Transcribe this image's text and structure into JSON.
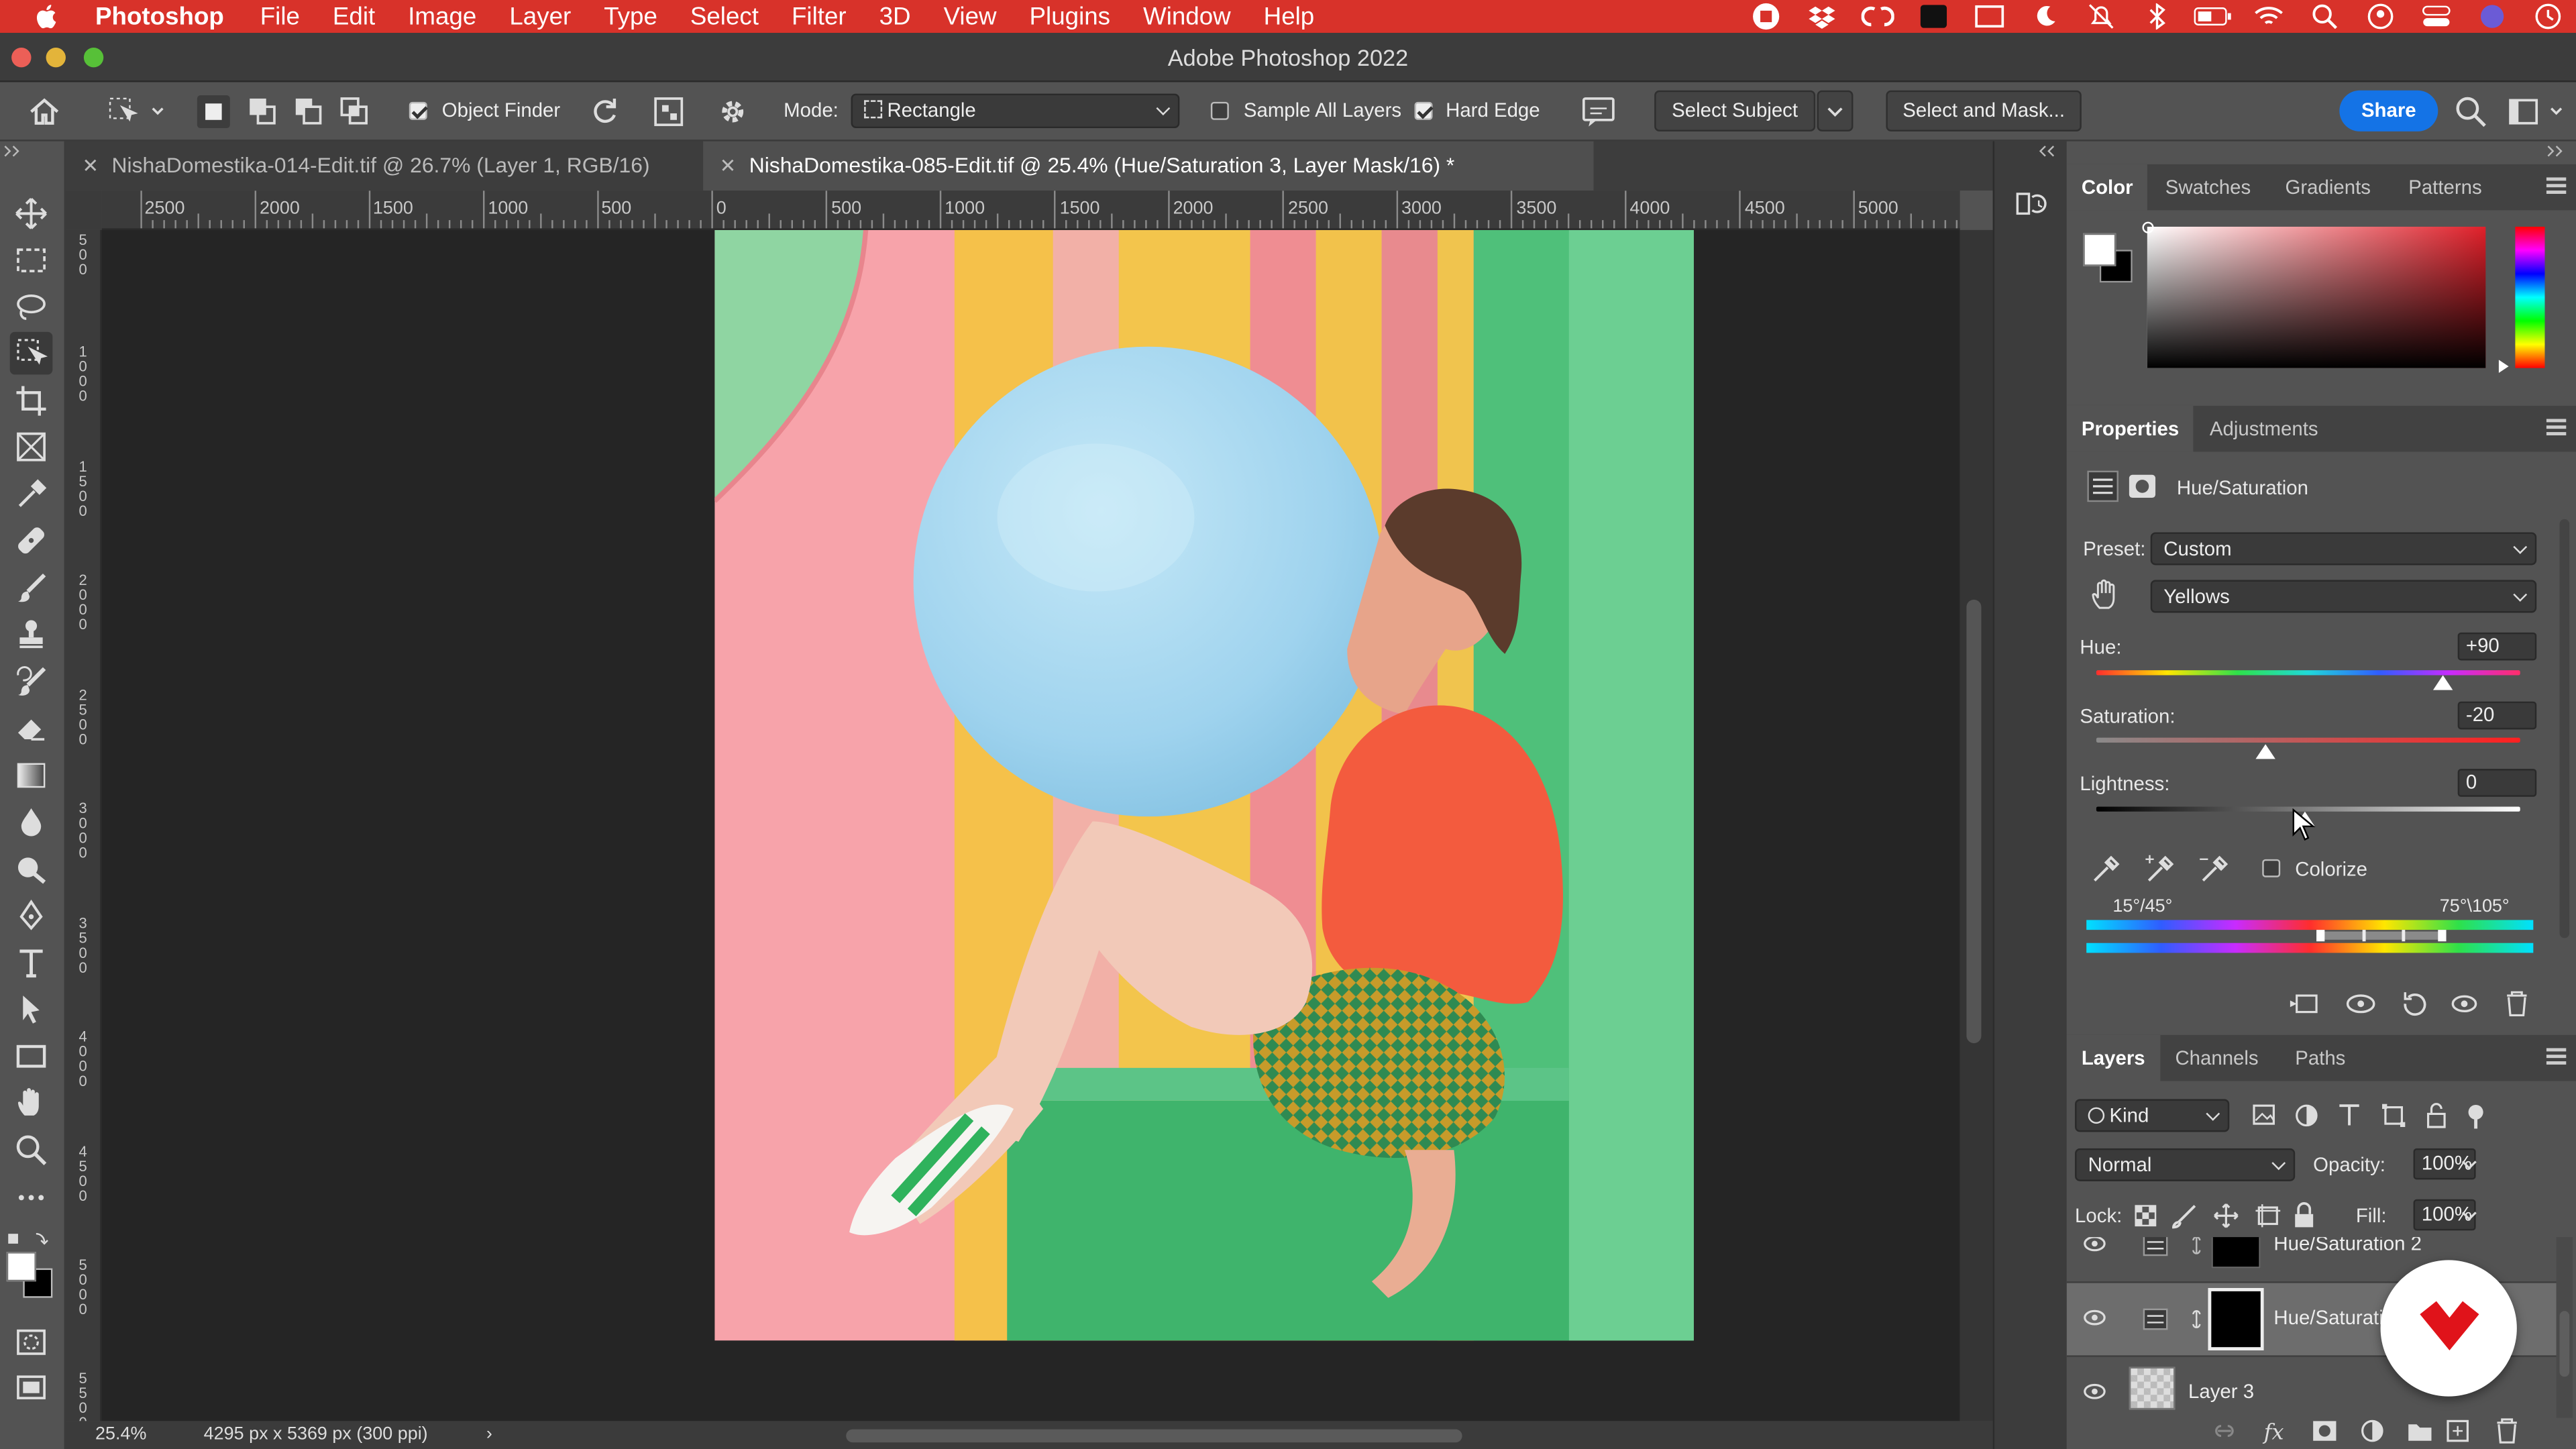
{
  "menubar": {
    "app": "Photoshop",
    "items": [
      "File",
      "Edit",
      "Image",
      "Layer",
      "Type",
      "Select",
      "Filter",
      "3D",
      "View",
      "Plugins",
      "Window",
      "Help"
    ]
  },
  "window": {
    "title": "Adobe Photoshop 2022"
  },
  "options_bar": {
    "object_finder": "Object Finder",
    "mode_label": "Mode:",
    "mode_value": "Rectangle",
    "sample_all_layers": "Sample All Layers",
    "hard_edge": "Hard Edge",
    "select_subject": "Select Subject",
    "select_and_mask": "Select and Mask...",
    "share": "Share"
  },
  "doc_tabs": [
    {
      "label": "NishaDomestika-014-Edit.tif @ 26.7% (Layer 1, RGB/16)"
    },
    {
      "label": "NishaDomestika-085-Edit.tif @ 25.4% (Hue/Saturation 3, Layer Mask/16) *"
    }
  ],
  "ruler_h": [
    "2500",
    "2000",
    "1500",
    "1000",
    "500",
    "0",
    "500",
    "1000",
    "1500",
    "2000",
    "2500",
    "3000",
    "3500",
    "4000",
    "4500",
    "5000"
  ],
  "ruler_v": [
    "5\n0\n0",
    "1\n0\n0\n0",
    "1\n5\n0\n0",
    "2\n0\n0\n0",
    "2\n5\n0\n0",
    "3\n0\n0\n0",
    "3\n5\n0\n0",
    "4\n0\n0\n0",
    "4\n5\n0\n0",
    "5\n0\n0\n0",
    "5\n5\n0\n0"
  ],
  "status": {
    "zoom": "25.4%",
    "info": "4295 px x 5369 px (300 ppi)",
    "arrow": "›"
  },
  "color_panel": {
    "tabs": [
      "Color",
      "Swatches",
      "Gradients",
      "Patterns"
    ],
    "fg": "#ffffff",
    "bg": "#000000"
  },
  "properties": {
    "tabs": [
      "Properties",
      "Adjustments"
    ],
    "title": "Hue/Saturation",
    "preset_label": "Preset:",
    "preset": "Custom",
    "channel": "Yellows",
    "hue_label": "Hue:",
    "hue": "+90",
    "saturation_label": "Saturation:",
    "saturation": "-20",
    "lightness_label": "Lightness:",
    "lightness": "0",
    "colorize": "Colorize",
    "range_left": "15°/45°",
    "range_right": "75°\\105°"
  },
  "layers": {
    "tabs": [
      "Layers",
      "Channels",
      "Paths"
    ],
    "kind": "Kind",
    "blend": "Normal",
    "opacity_label": "Opacity:",
    "opacity": "100%",
    "lock_label": "Lock:",
    "fill_label": "Fill:",
    "fill": "100%",
    "items": [
      {
        "name": "Hue/Saturation 2"
      },
      {
        "name": "Hue/Saturati"
      },
      {
        "name": "Layer 3"
      }
    ]
  }
}
